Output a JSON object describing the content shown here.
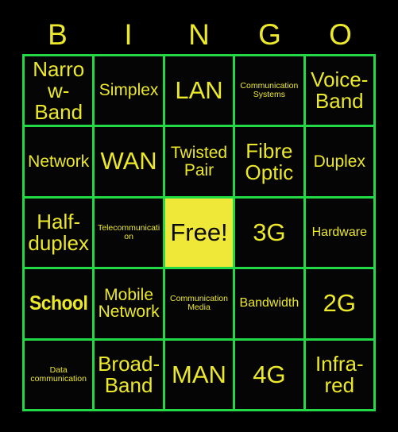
{
  "card": {
    "title": "BINGO",
    "header_letters": [
      "B",
      "I",
      "N",
      "G",
      "O"
    ],
    "colors": {
      "background": "#000000",
      "grid_line": "#22d845",
      "text": "#ece82a",
      "free_space_background": "#f0e838",
      "free_space_text": "#0a0a0a"
    },
    "grid_size": "5x5",
    "cells": [
      {
        "text": "Narrow-Band",
        "size": "lg",
        "type": "term"
      },
      {
        "text": "Simplex",
        "size": "md",
        "type": "term"
      },
      {
        "text": "LAN",
        "size": "xl",
        "type": "term"
      },
      {
        "text": "Communication Systems",
        "size": "xs",
        "type": "term"
      },
      {
        "text": "Voice-Band",
        "size": "lg",
        "type": "term"
      },
      {
        "text": "Network",
        "size": "md",
        "type": "term"
      },
      {
        "text": "WAN",
        "size": "xl",
        "type": "term"
      },
      {
        "text": "Twisted Pair",
        "size": "md",
        "type": "term"
      },
      {
        "text": "Fibre Optic",
        "size": "lg",
        "type": "term"
      },
      {
        "text": "Duplex",
        "size": "md",
        "type": "term"
      },
      {
        "text": "Half-duplex",
        "size": "lg",
        "type": "term"
      },
      {
        "text": "Telecommunication",
        "size": "xs",
        "type": "term"
      },
      {
        "text": "Free!",
        "size": "xl",
        "type": "free"
      },
      {
        "text": "3G",
        "size": "xl",
        "type": "term"
      },
      {
        "text": "Hardware",
        "size": "sm",
        "type": "term"
      },
      {
        "text": "School",
        "size": "lg",
        "type": "logo"
      },
      {
        "text": "Mobile Network",
        "size": "md",
        "type": "term"
      },
      {
        "text": "Communication Media",
        "size": "xs",
        "type": "term"
      },
      {
        "text": "Bandwidth",
        "size": "sm",
        "type": "term"
      },
      {
        "text": "2G",
        "size": "xl",
        "type": "term"
      },
      {
        "text": "Data communication",
        "size": "xs",
        "type": "term"
      },
      {
        "text": "Broad-Band",
        "size": "lg",
        "type": "term"
      },
      {
        "text": "MAN",
        "size": "xl",
        "type": "term"
      },
      {
        "text": "4G",
        "size": "xl",
        "type": "term"
      },
      {
        "text": "Infra-red",
        "size": "lg",
        "type": "term"
      }
    ]
  }
}
